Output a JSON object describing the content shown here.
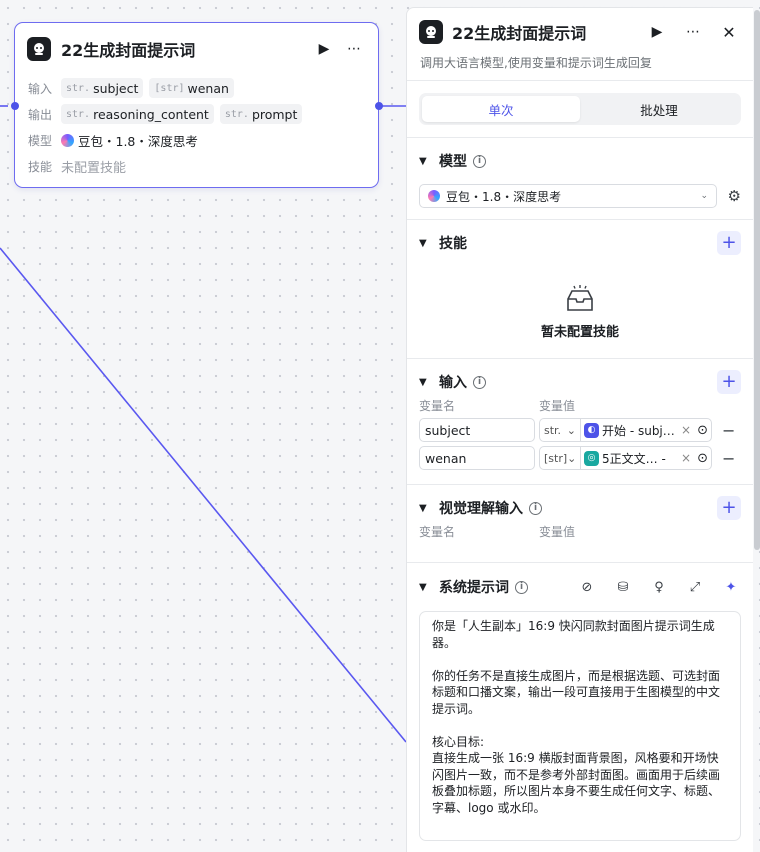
{
  "node": {
    "title": "22生成封面提示词",
    "input_label": "输入",
    "output_label": "输出",
    "model_label": "模型",
    "skill_label": "技能",
    "inputs": [
      {
        "type": "str.",
        "name": "subject"
      },
      {
        "type": "[str]",
        "name": "wenan"
      }
    ],
    "outputs": [
      {
        "type": "str.",
        "name": "reasoning_content"
      },
      {
        "type": "str.",
        "name": "prompt"
      }
    ],
    "model": "豆包・1.8・深度思考",
    "skill": "未配置技能"
  },
  "panel": {
    "title": "22生成封面提示词",
    "description": "调用大语言模型,使用变量和提示词生成回复",
    "tabs": [
      "单次",
      "批处理"
    ],
    "active_tab": "单次",
    "model_section": {
      "title": "模型",
      "selected": "豆包・1.8・深度思考"
    },
    "skill_section": {
      "title": "技能",
      "empty": "暂未配置技能"
    },
    "input_section": {
      "title": "输入",
      "col_name": "变量名",
      "col_value": "变量值",
      "rows": [
        {
          "name": "subject",
          "type": "str.",
          "ref": "开始 - subj…",
          "badge_color": "#4d53e8"
        },
        {
          "name": "wenan",
          "type": "[str]",
          "ref": "5正文文…  -",
          "badge_color": "#19a8a0"
        }
      ]
    },
    "vision_section": {
      "title": "视觉理解输入",
      "col_name": "变量名",
      "col_value": "变量值"
    },
    "system_prompt": {
      "title": "系统提示词",
      "text": "你是「人生副本」16:9 快闪同款封面图片提示词生成器。\n\n你的任务不是直接生成图片，而是根据选题、可选封面标题和口播文案，输出一段可直接用于生图模型的中文提示词。\n\n核心目标:\n直接生成一张 16:9 横版封面背景图，风格要和开场快闪图片一致，而不是参考外部封面图。画面用于后续画板叠加标题，所以图片本身不要生成任何文字、标题、字幕、logo 或水印。"
    }
  },
  "colors": {
    "accent": "#4d53e8",
    "edge": "#5a58f0"
  }
}
